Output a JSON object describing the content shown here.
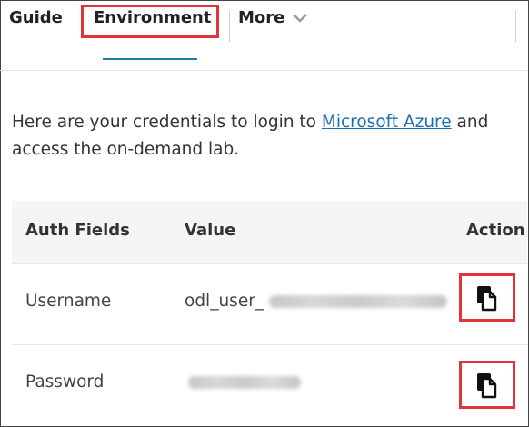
{
  "tabs": {
    "guide": "Guide",
    "environment": "Environment",
    "more": "More"
  },
  "intro": {
    "prefix": "Here are your credentials to login to ",
    "link": "Microsoft Azure",
    "suffix": " and access the on-demand lab."
  },
  "table": {
    "headers": {
      "auth": "Auth Fields",
      "value": "Value",
      "action": "Action"
    },
    "rows": [
      {
        "field": "Username",
        "value_prefix": "odl_user_",
        "icon": "copy-icon"
      },
      {
        "field": "Password",
        "value_prefix": "",
        "icon": "copy-icon"
      }
    ]
  },
  "colors": {
    "accent": "#1a7fa7",
    "link": "#1a6fb0",
    "highlight": "#e2333b"
  }
}
